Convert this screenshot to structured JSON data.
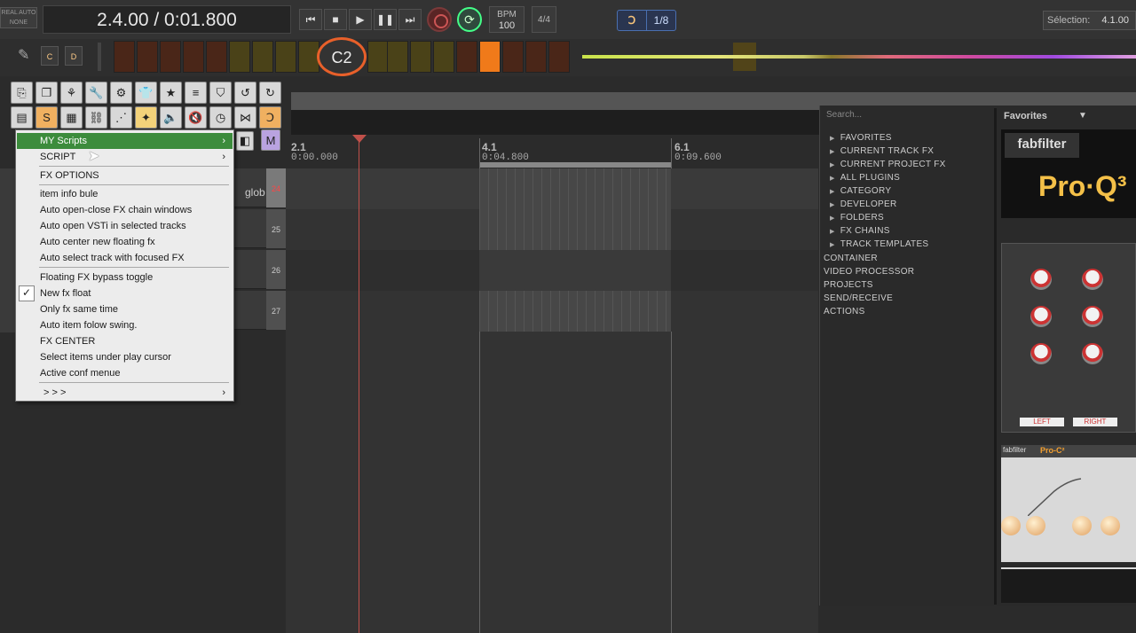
{
  "transport": {
    "auto_badge_line1": "REAL AUTO",
    "auto_badge_line2": "NONE",
    "position": "2.4.00 / 0:01.800",
    "bpm_label": "BPM",
    "bpm_value": "100",
    "time_sig": "4/4",
    "grid_value": "1/8",
    "selection_label": "Sélection:",
    "selection_value": "4.1.00"
  },
  "pads": {
    "note_label": "C2",
    "btn_c": "C",
    "btn_d": "D"
  },
  "ruler": {
    "markers": [
      {
        "bar": "2.1",
        "time": "0:00.000"
      },
      {
        "bar": "4.1",
        "time": "0:04.800"
      },
      {
        "bar": "6.1",
        "time": "0:09.600"
      }
    ]
  },
  "tracks": {
    "numbers": [
      "24",
      "25",
      "26",
      "27"
    ],
    "partial_name": "glob"
  },
  "context_menu": {
    "items": [
      {
        "label": "MY Scripts",
        "submenu": true
      },
      {
        "label": "SCRIPT",
        "submenu": true
      },
      {
        "label": "FX OPTIONS"
      },
      {
        "label": "item info bule"
      },
      {
        "label": "Auto open-close FX chain windows"
      },
      {
        "label": "Auto open VSTi in selected tracks"
      },
      {
        "label": "Auto center new floating fx"
      },
      {
        "label": "Auto select track with focused FX"
      },
      {
        "label": "Floating FX bypass toggle"
      },
      {
        "label": "New fx float",
        "checked": true
      },
      {
        "label": "Only fx same time"
      },
      {
        "label": "Auto item folow swing."
      },
      {
        "label": "FX CENTER"
      },
      {
        "label": "Select items under play cursor"
      },
      {
        "label": "Active conf menue"
      },
      {
        "label": "> > >",
        "submenu": true
      }
    ]
  },
  "fx_browser": {
    "search_placeholder": "Search...",
    "tree": [
      "FAVORITES",
      "CURRENT TRACK FX",
      "CURRENT PROJECT FX",
      "ALL PLUGINS",
      "CATEGORY",
      "DEVELOPER",
      "FOLDERS",
      "FX CHAINS",
      "TRACK TEMPLATES"
    ],
    "flat": [
      "CONTAINER",
      "VIDEO PROCESSOR",
      "PROJECTS",
      "SEND/RECEIVE",
      "ACTIONS"
    ],
    "favorites_title": "Favorites",
    "plugin1_logo": "fabfilter",
    "plugin1_name": "Pro·Q³",
    "plugin2_left": "LEFT",
    "plugin2_right": "RIGHT",
    "plugin3_name": "Pro-C²",
    "plugin3_logo": "fabfilter"
  },
  "colors": {
    "menu_highlight": "#3c8c3c",
    "playhead": "#c0504a",
    "pad_lit": "#f07a1a"
  }
}
